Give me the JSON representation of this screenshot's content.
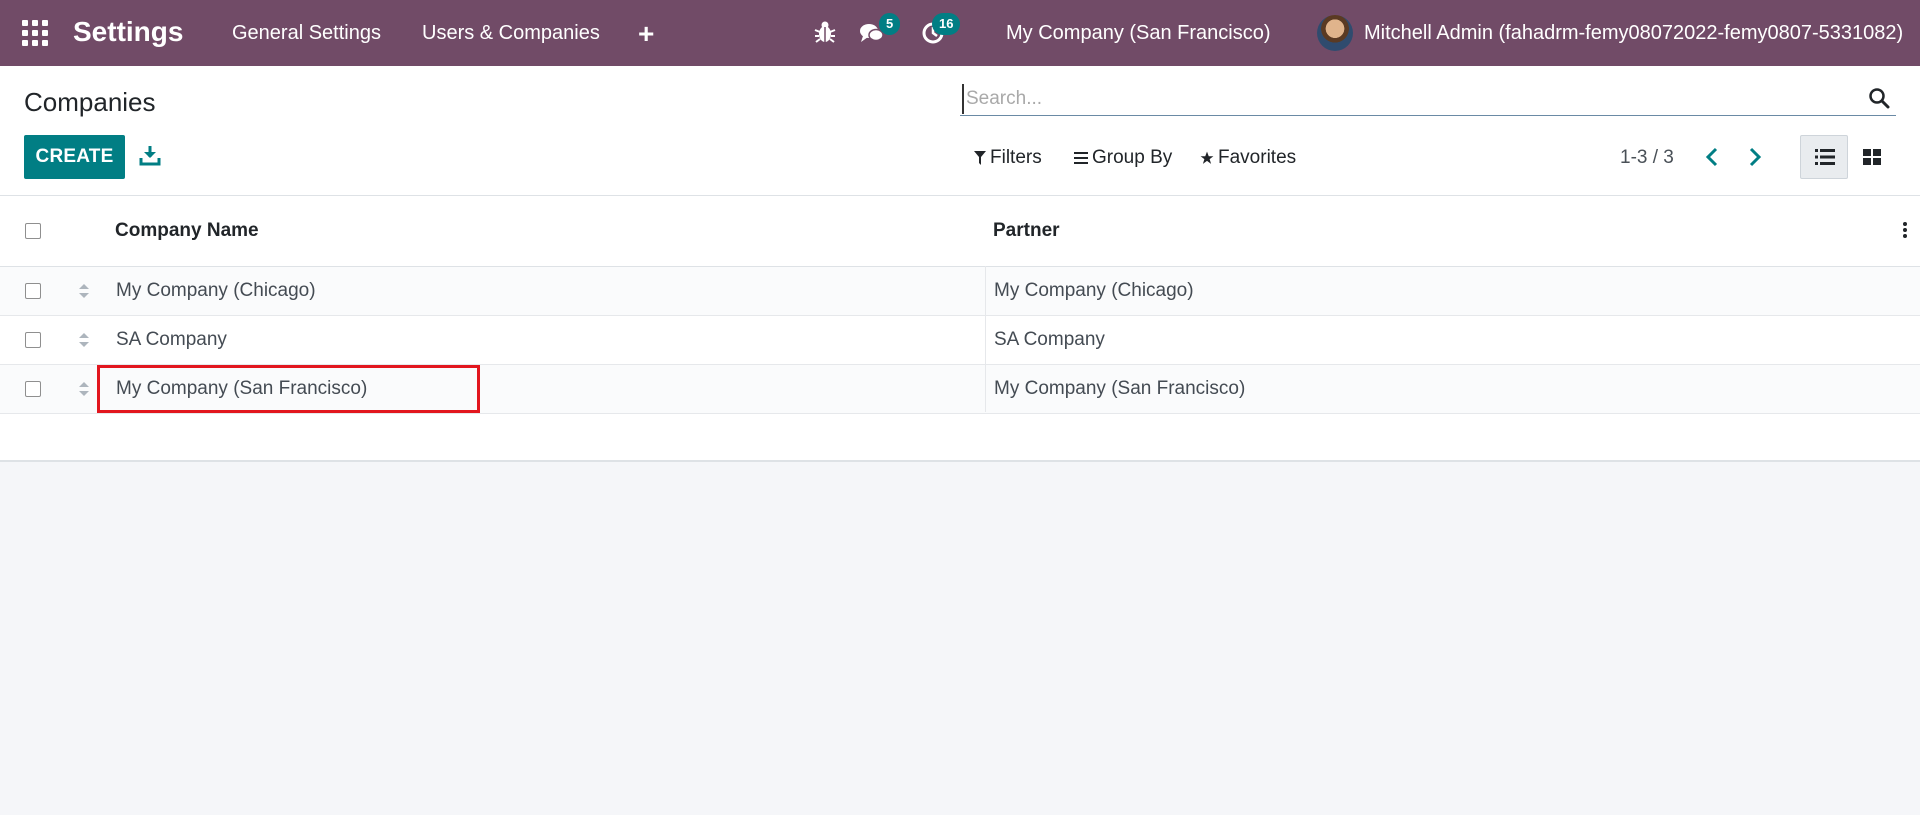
{
  "navbar": {
    "brand": "Settings",
    "menu": [
      "General Settings",
      "Users & Companies"
    ],
    "messages_count": "5",
    "activities_count": "16",
    "company": "My Company (San Francisco)",
    "user": "Mitchell Admin (fahadrm-femy08072022-femy0807-5331082)",
    "icons": [
      "apps-grid-icon",
      "plus-icon",
      "bug-icon",
      "chat-icon",
      "clock-icon",
      "avatar"
    ]
  },
  "control_panel": {
    "title": "Companies",
    "search_placeholder": "Search...",
    "create_label": "CREATE",
    "filters_label": "Filters",
    "group_by_label": "Group By",
    "favorites_label": "Favorites",
    "pager": "1-3 / 3"
  },
  "list": {
    "columns": [
      "Company Name",
      "Partner"
    ],
    "rows": [
      {
        "name": "My Company (Chicago)",
        "partner": "My Company (Chicago)"
      },
      {
        "name": "SA Company",
        "partner": "SA Company"
      },
      {
        "name": "My Company (San Francisco)",
        "partner": "My Company (San Francisco)"
      }
    ]
  },
  "colors": {
    "navbar": "#714b67",
    "primary": "#017e84",
    "highlight": "#e2161e"
  }
}
